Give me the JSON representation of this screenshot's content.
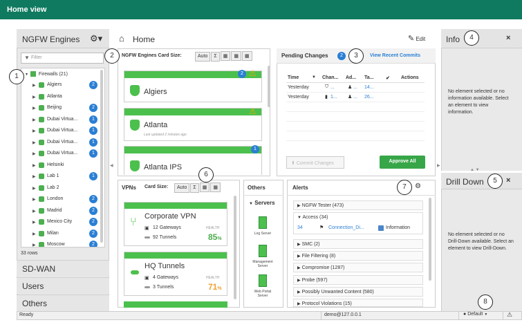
{
  "window": {
    "title": "Home view"
  },
  "callouts": [
    "1",
    "2",
    "3",
    "4",
    "5",
    "6",
    "7",
    "8"
  ],
  "left": {
    "title": "NGFW Engines",
    "filter_placeholder": "Filter",
    "root": "Firewalls (21)",
    "items": [
      {
        "label": "Algiers",
        "badge": "2"
      },
      {
        "label": "Atlanta",
        "badge": ""
      },
      {
        "label": "Beijing",
        "badge": "2"
      },
      {
        "label": "Dubai Virtua...",
        "badge": "1"
      },
      {
        "label": "Dubai Virtua...",
        "badge": "1"
      },
      {
        "label": "Dubai Virtua...",
        "badge": "1"
      },
      {
        "label": "Dubai Virtua...",
        "badge": "1"
      },
      {
        "label": "Helsinki",
        "badge": ""
      },
      {
        "label": "Lab 1",
        "badge": "1"
      },
      {
        "label": "Lab 2",
        "badge": ""
      },
      {
        "label": "London",
        "badge": "2"
      },
      {
        "label": "Madrid",
        "badge": "2"
      },
      {
        "label": "Mexico City",
        "badge": "2"
      },
      {
        "label": "Milan",
        "badge": "2"
      },
      {
        "label": "Moscow",
        "badge": "2"
      }
    ],
    "rows_count": "33 rows",
    "sections": [
      "SD-WAN",
      "Users",
      "Others"
    ]
  },
  "center": {
    "home_label": "Home",
    "edit_label": "Edit",
    "engines_title": "NGFW Engines",
    "card_size_label": "Card Size:",
    "auto_label": "Auto",
    "sigma": "Σ",
    "cards": [
      {
        "name": "Algiers",
        "badge": "2",
        "sub": ""
      },
      {
        "name": "Atlanta",
        "badge": "",
        "sub": "Last updated 2 minutes ago"
      },
      {
        "name": "Atlanta IPS",
        "badge": "1",
        "sub": ""
      }
    ],
    "vpns_title": "VPNs",
    "vpn_cards": [
      {
        "name": "Corporate VPN",
        "gateways": "12 Gateways",
        "tunnels": "92 Tunnels",
        "health_label": "HEALTH",
        "health": "85",
        "unit": "%",
        "color": "#4cae4c"
      },
      {
        "name": "HQ Tunnels",
        "gateways": "4 Gateways",
        "tunnels": "3 Tunnels",
        "health_label": "HEALTH",
        "health": "71",
        "unit": "%",
        "color": "#f0a030"
      }
    ],
    "others_title": "Others",
    "servers_label": "Servers",
    "servers": [
      "Log Server",
      "Management Server",
      "Web Portal Server"
    ]
  },
  "pending": {
    "title": "Pending Changes",
    "count": "2",
    "view_link": "View Recent Commits",
    "columns": [
      "Time",
      "Chan...",
      "Ad...",
      "Ta...",
      "✔",
      "Actions"
    ],
    "rows": [
      {
        "time": "Yesterday",
        "chan": "...",
        "ad": "...",
        "ta": "14..."
      },
      {
        "time": "Yesterday",
        "chan": "1...",
        "ad": "...",
        "ta": "26..."
      }
    ],
    "commit_label": "Commit Changes",
    "approve_label": "Approve All"
  },
  "alerts": {
    "title": "Alerts",
    "groups": [
      {
        "label": "NGFW Tester (473)",
        "open": false
      },
      {
        "label": "Access (34)",
        "open": true
      },
      {
        "label": "SMC (2)",
        "open": false
      },
      {
        "label": "File Filtering (8)",
        "open": false
      },
      {
        "label": "Compromise (1287)",
        "open": false
      },
      {
        "label": "Probe (597)",
        "open": false
      },
      {
        "label": "Possibly Unwanted Content (580)",
        "open": false
      },
      {
        "label": "Protocol Violations (15)",
        "open": false
      }
    ],
    "detail": {
      "count": "34",
      "name": "Connection_Di...",
      "severity": "Information"
    }
  },
  "info": {
    "title": "Info",
    "text": "No element selected or no information available. Select an element to view information."
  },
  "drill": {
    "title": "Drill Down",
    "text": "No element selected or no Drill-Down available. Select an element to view Drill-Down."
  },
  "status": {
    "ready": "Ready",
    "user": "demo@127.0.0.1",
    "profile": "Default",
    "warning": "⚠"
  },
  "colors": {
    "brand": "#0f7a5f",
    "green": "#4cc04c",
    "badge": "#2a7fd4",
    "link": "#2a7fd4"
  }
}
